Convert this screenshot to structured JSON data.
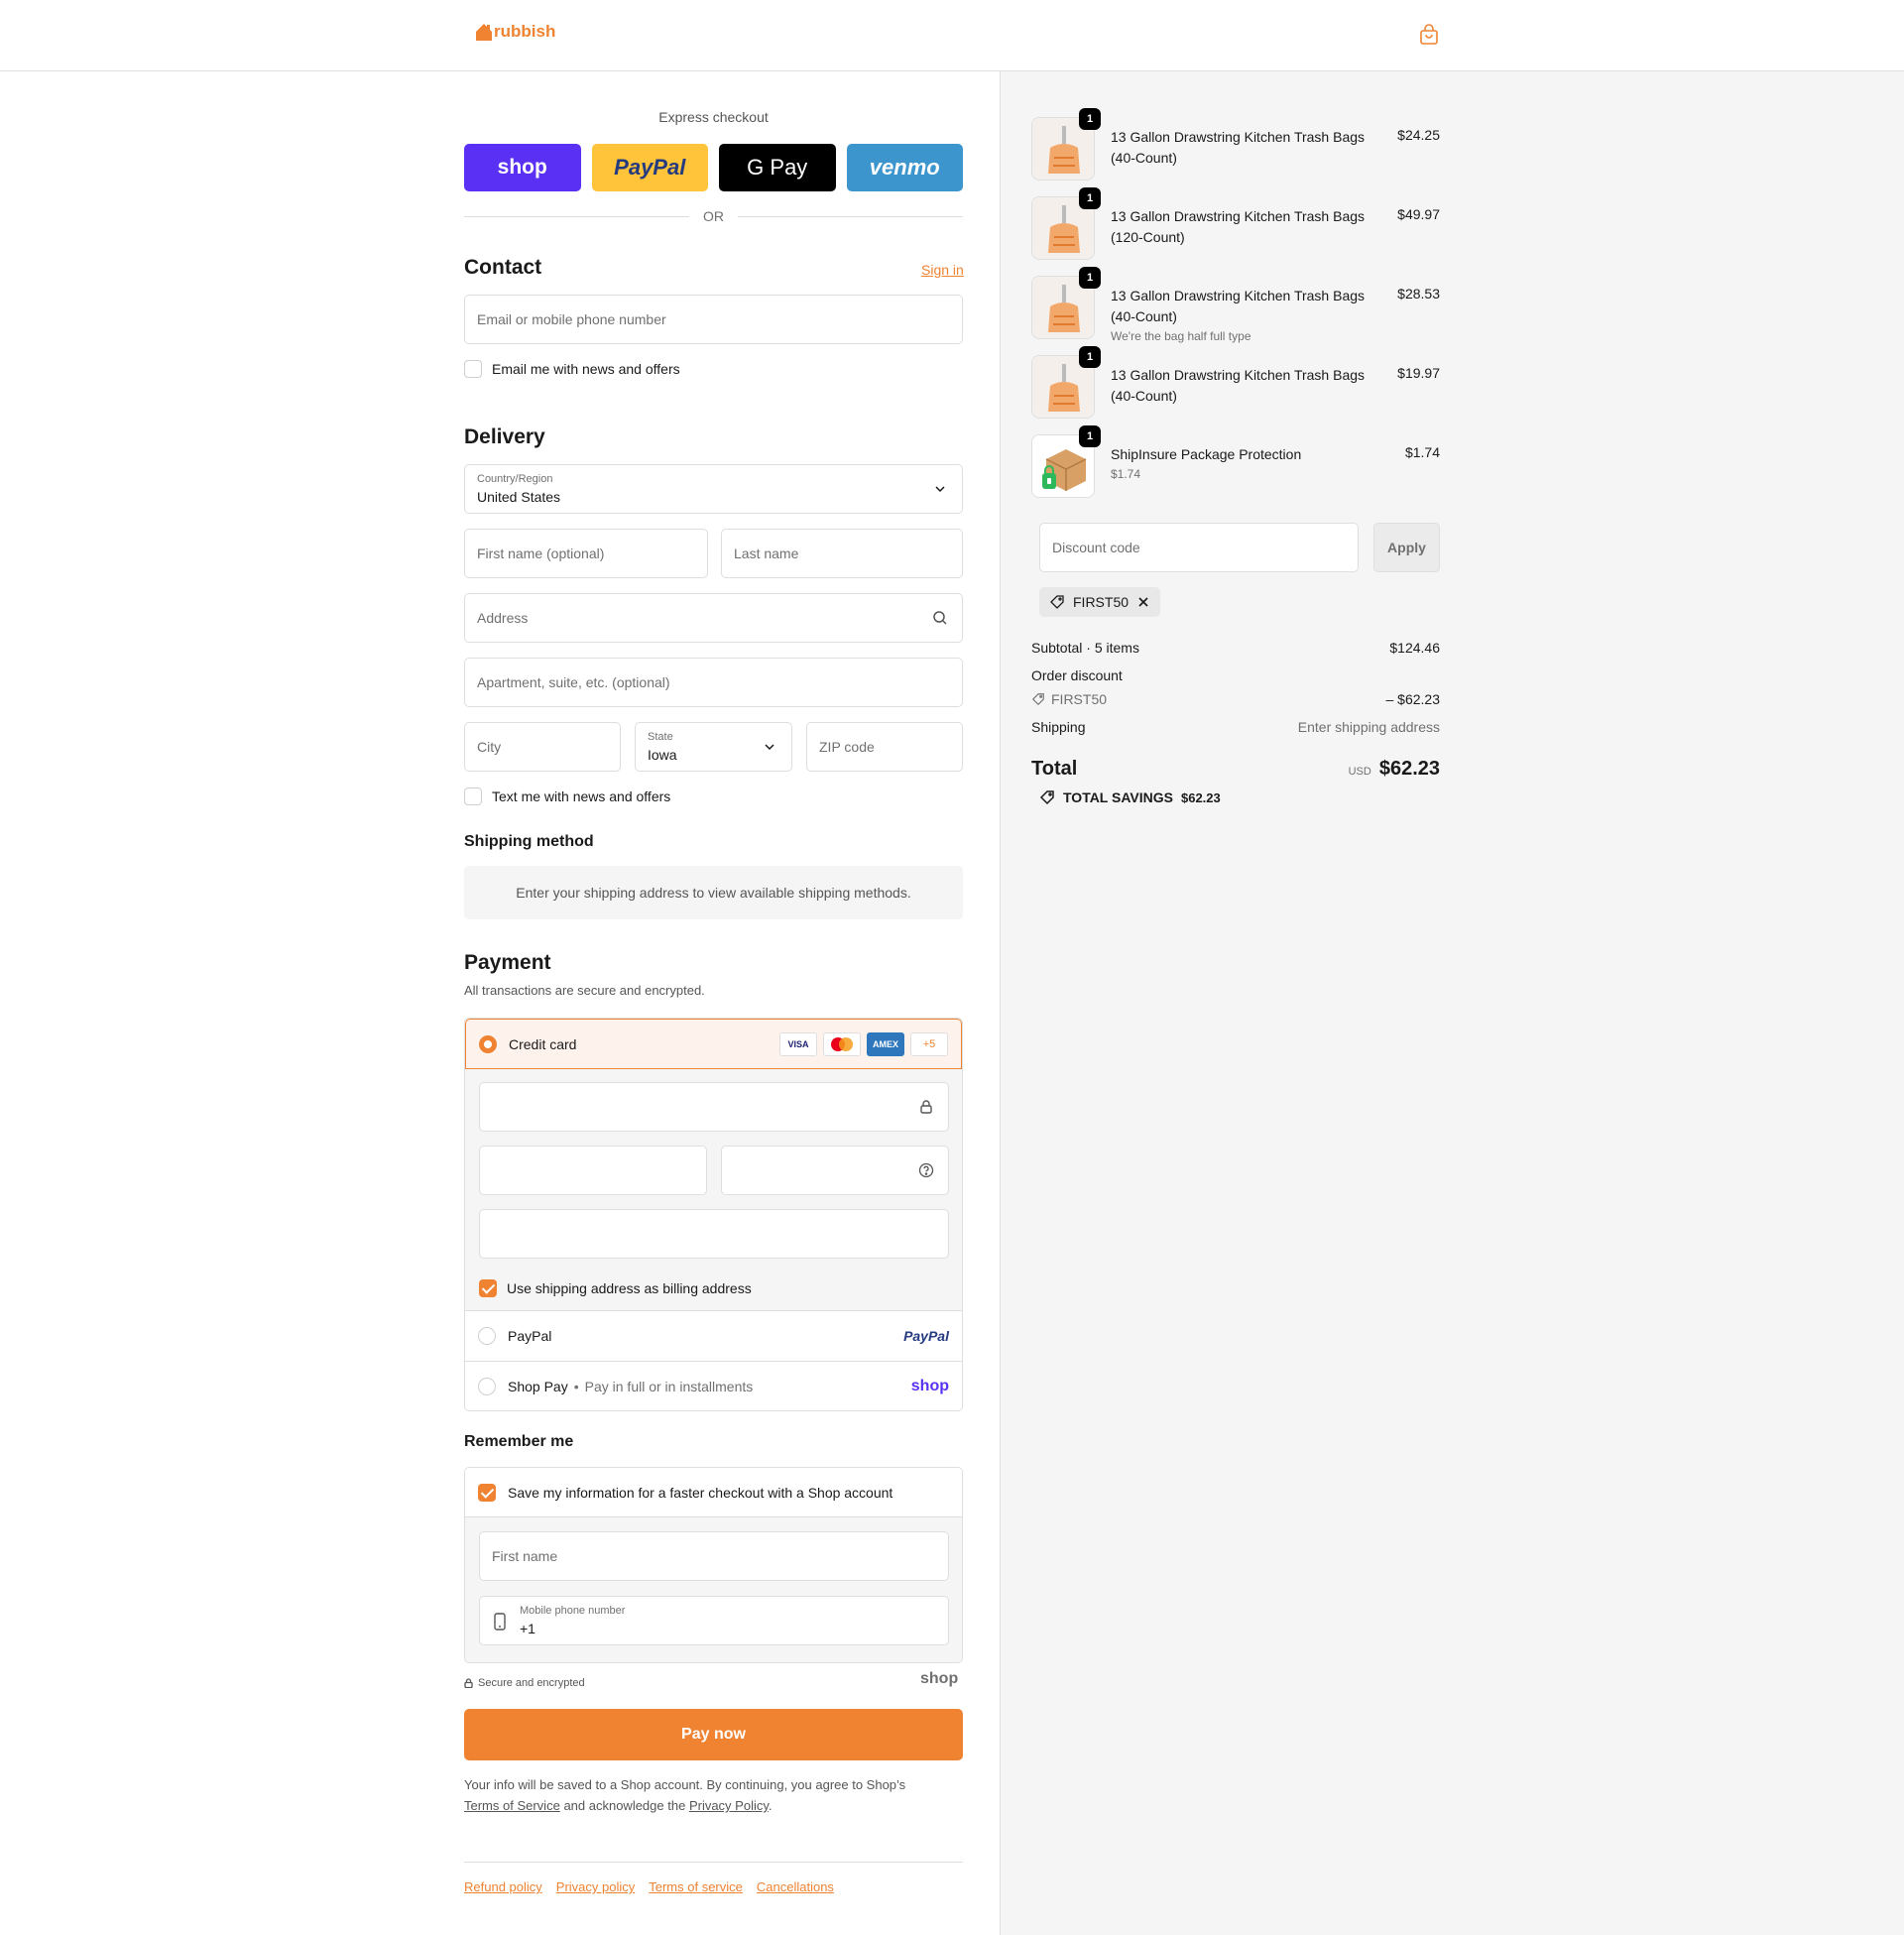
{
  "header": {
    "logo_text": "rubbish",
    "brand_color": "#f08332"
  },
  "express": {
    "title": "Express checkout",
    "buttons": {
      "shop": "shop",
      "paypal": "PayPal",
      "gpay": "G Pay",
      "venmo": "venmo"
    },
    "or_label": "OR"
  },
  "contact": {
    "heading": "Contact",
    "sign_in": "Sign in",
    "email_placeholder": "Email or mobile phone number",
    "email_news_label": "Email me with news and offers"
  },
  "delivery": {
    "heading": "Delivery",
    "country_label": "Country/Region",
    "country_value": "United States",
    "first_name_placeholder": "First name (optional)",
    "last_name_placeholder": "Last name",
    "address_placeholder": "Address",
    "apartment_placeholder": "Apartment, suite, etc. (optional)",
    "city_placeholder": "City",
    "state_label": "State",
    "state_value": "Iowa",
    "zip_placeholder": "ZIP code",
    "text_news_label": "Text me with news and offers"
  },
  "shipping_method": {
    "heading": "Shipping method",
    "note": "Enter your shipping address to view available shipping methods."
  },
  "payment": {
    "heading": "Payment",
    "subtitle": "All transactions are secure and encrypted.",
    "credit_card_label": "Credit card",
    "card_badges": [
      "VISA",
      "MC",
      "AMEX",
      "+5"
    ],
    "billing_same_label": "Use shipping address as billing address",
    "paypal_label": "PayPal",
    "paypal_logo": "PayPal",
    "shop_pay_label": "Shop Pay",
    "shop_pay_sub": "Pay in full or in installments",
    "shop_pay_logo": "shop"
  },
  "remember": {
    "heading": "Remember me",
    "save_label": "Save my information for a faster checkout with a Shop account",
    "first_name_placeholder": "First name",
    "phone_label": "Mobile phone number",
    "phone_value": "+1",
    "secure_label": "Secure and encrypted",
    "shop_logo": "shop"
  },
  "pay_now": "Pay now",
  "legal": {
    "text_1": "Your info will be saved to a Shop account. By continuing, you agree to Shop’s",
    "tos": "Terms of Service",
    "text_2": "and acknowledge the",
    "privacy": "Privacy Policy",
    "text_3": "."
  },
  "footer_links": [
    "Refund policy",
    "Privacy policy",
    "Terms of service",
    "Cancellations"
  ],
  "order": {
    "items": [
      {
        "name": "13 Gallon Drawstring Kitchen Trash Bags (40-Count)",
        "sub": "",
        "price": "$24.25",
        "qty": "1"
      },
      {
        "name": "13 Gallon Drawstring Kitchen Trash Bags (120-Count)",
        "sub": "",
        "price": "$49.97",
        "qty": "1"
      },
      {
        "name": "13 Gallon Drawstring Kitchen Trash Bags (40-Count)",
        "sub": "We're the bag half full type",
        "price": "$28.53",
        "qty": "1"
      },
      {
        "name": "13 Gallon Drawstring Kitchen Trash Bags (40-Count)",
        "sub": "",
        "price": "$19.97",
        "qty": "1"
      },
      {
        "name": "ShipInsure Package Protection",
        "sub": "$1.74",
        "price": "$1.74",
        "qty": "1"
      }
    ],
    "discount_placeholder": "Discount code",
    "apply_label": "Apply",
    "applied_code": "FIRST50",
    "subtotal_label": "Subtotal · 5 items",
    "subtotal_value": "$124.46",
    "order_discount_label": "Order discount",
    "discount_code": "FIRST50",
    "discount_value": "– $62.23",
    "shipping_label": "Shipping",
    "shipping_value": "Enter shipping address",
    "total_label": "Total",
    "currency": "USD",
    "total_value": "$62.23",
    "savings_label": "TOTAL SAVINGS",
    "savings_value": "$62.23"
  }
}
